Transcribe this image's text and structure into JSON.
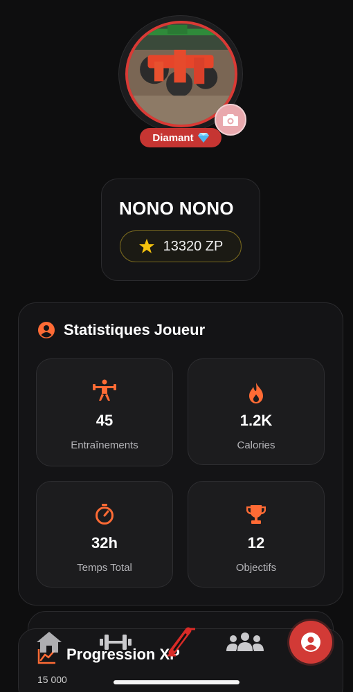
{
  "profile": {
    "rank": "Diamant",
    "name": "NONO NONO",
    "zp": "13320 ZP"
  },
  "stats": {
    "title": "Statistiques Joueur",
    "tiles": [
      {
        "icon": "weightlifter-icon",
        "value": "45",
        "label": "Entraînements"
      },
      {
        "icon": "flame-icon",
        "value": "1.2K",
        "label": "Calories"
      },
      {
        "icon": "timer-icon",
        "value": "32h",
        "label": "Temps Total"
      },
      {
        "icon": "trophy-icon",
        "value": "12",
        "label": "Objectifs"
      }
    ]
  },
  "progression": {
    "title": "Progression XP",
    "axis_top": "15 000"
  },
  "nav": {
    "items": [
      "home-icon",
      "dumbbell-icon",
      "logo-icon",
      "group-icon",
      "profile-icon"
    ],
    "active": "profile-icon"
  },
  "colors": {
    "accent": "#ff6b35",
    "red": "#d23a36",
    "gold": "#f4c20d"
  }
}
